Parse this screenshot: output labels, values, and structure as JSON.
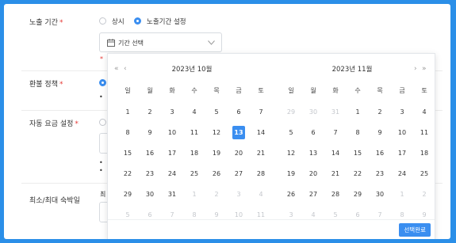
{
  "form": {
    "exposure": {
      "label": "노출 기간",
      "required": "*",
      "options": [
        "상시",
        "노출기간 설정"
      ],
      "selected_index": 1,
      "date_placeholder": "기간 선택",
      "error_fragment": "*"
    },
    "refund": {
      "label": "환불 정책",
      "required": "*",
      "bullet": "•"
    },
    "auto_fare": {
      "label": "자동 요금 설정",
      "required": "*",
      "bullets": [
        "•",
        "•"
      ]
    },
    "stay": {
      "label": "최소/최대 숙박일",
      "field_fragment": "최"
    }
  },
  "calendar": {
    "nav": {
      "prev_year": "«",
      "prev_month": "‹",
      "next_month": "›",
      "next_year": "»"
    },
    "weekdays": [
      "일",
      "월",
      "화",
      "수",
      "목",
      "금",
      "토"
    ],
    "months": [
      {
        "title": "2023년  10월",
        "weeks": [
          [
            {
              "d": "1"
            },
            {
              "d": "2"
            },
            {
              "d": "3"
            },
            {
              "d": "4"
            },
            {
              "d": "5"
            },
            {
              "d": "6"
            },
            {
              "d": "7"
            }
          ],
          [
            {
              "d": "8"
            },
            {
              "d": "9"
            },
            {
              "d": "10"
            },
            {
              "d": "11"
            },
            {
              "d": "12"
            },
            {
              "d": "13",
              "sel": true
            },
            {
              "d": "14"
            }
          ],
          [
            {
              "d": "15"
            },
            {
              "d": "16"
            },
            {
              "d": "17"
            },
            {
              "d": "18"
            },
            {
              "d": "19"
            },
            {
              "d": "20"
            },
            {
              "d": "21"
            }
          ],
          [
            {
              "d": "22"
            },
            {
              "d": "23"
            },
            {
              "d": "24"
            },
            {
              "d": "25"
            },
            {
              "d": "26"
            },
            {
              "d": "27"
            },
            {
              "d": "28"
            }
          ],
          [
            {
              "d": "29"
            },
            {
              "d": "30"
            },
            {
              "d": "31"
            },
            {
              "d": "1",
              "out": true
            },
            {
              "d": "2",
              "out": true
            },
            {
              "d": "3",
              "out": true
            },
            {
              "d": "4",
              "out": true
            }
          ],
          [
            {
              "d": "5",
              "out": true
            },
            {
              "d": "6",
              "out": true
            },
            {
              "d": "7",
              "out": true
            },
            {
              "d": "8",
              "out": true
            },
            {
              "d": "9",
              "out": true
            },
            {
              "d": "10",
              "out": true
            },
            {
              "d": "11",
              "out": true
            }
          ]
        ]
      },
      {
        "title": "2023년  11월",
        "weeks": [
          [
            {
              "d": "29",
              "out": true
            },
            {
              "d": "30",
              "out": true
            },
            {
              "d": "31",
              "out": true
            },
            {
              "d": "1"
            },
            {
              "d": "2"
            },
            {
              "d": "3"
            },
            {
              "d": "4"
            }
          ],
          [
            {
              "d": "5"
            },
            {
              "d": "6"
            },
            {
              "d": "7"
            },
            {
              "d": "8"
            },
            {
              "d": "9"
            },
            {
              "d": "10"
            },
            {
              "d": "11"
            }
          ],
          [
            {
              "d": "12"
            },
            {
              "d": "13"
            },
            {
              "d": "14"
            },
            {
              "d": "15"
            },
            {
              "d": "16"
            },
            {
              "d": "17"
            },
            {
              "d": "18"
            }
          ],
          [
            {
              "d": "19"
            },
            {
              "d": "20"
            },
            {
              "d": "21"
            },
            {
              "d": "22"
            },
            {
              "d": "23"
            },
            {
              "d": "24"
            },
            {
              "d": "25"
            }
          ],
          [
            {
              "d": "26"
            },
            {
              "d": "27"
            },
            {
              "d": "28"
            },
            {
              "d": "29"
            },
            {
              "d": "30"
            },
            {
              "d": "1",
              "out": true
            },
            {
              "d": "2",
              "out": true
            }
          ],
          [
            {
              "d": "3",
              "out": true
            },
            {
              "d": "4",
              "out": true
            },
            {
              "d": "5",
              "out": true
            },
            {
              "d": "6",
              "out": true
            },
            {
              "d": "7",
              "out": true
            },
            {
              "d": "8",
              "out": true
            },
            {
              "d": "9",
              "out": true
            }
          ]
        ]
      }
    ],
    "done_label": "선택완료"
  },
  "colors": {
    "accent": "#3a8ef0",
    "frame": "#2b8fe8",
    "required": "#e53935"
  }
}
